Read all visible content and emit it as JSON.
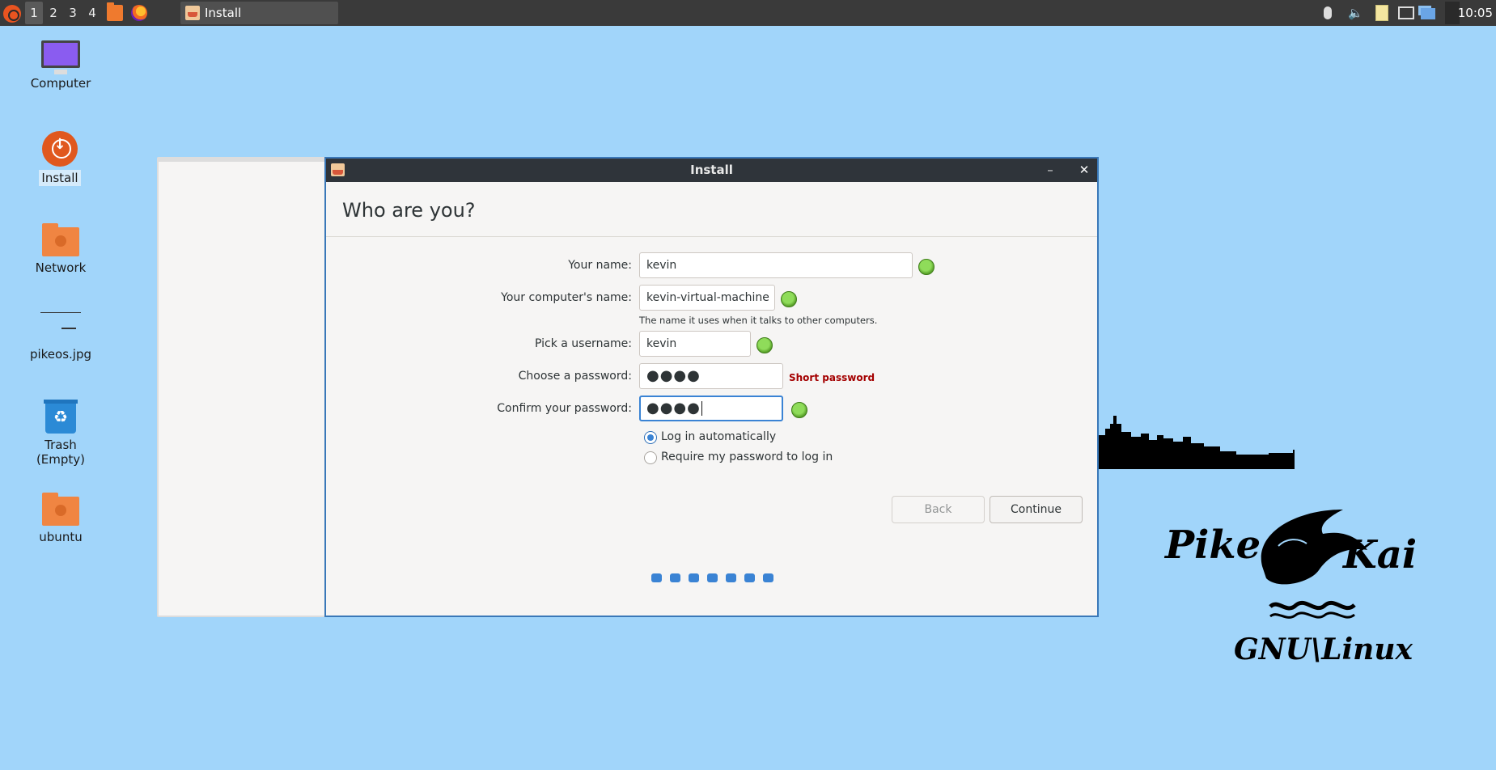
{
  "panel": {
    "workspaces": [
      "1",
      "2",
      "3",
      "4"
    ],
    "task_label": "Install",
    "clock": "10:05"
  },
  "desktop": {
    "icons": [
      {
        "label": "Computer"
      },
      {
        "label": "Install"
      },
      {
        "label": "Network"
      },
      {
        "label": "pikeos.jpg"
      },
      {
        "label": "Trash (Empty)"
      },
      {
        "label": "ubuntu"
      }
    ],
    "logo": {
      "line1_left": "Pike",
      "line1_right": "Kai",
      "line2": "GNU\\Linux"
    }
  },
  "window": {
    "title": "Install",
    "minimize_glyph": "–",
    "close_glyph": "✕",
    "heading": "Who are you?",
    "fields": {
      "name": {
        "label": "Your name:",
        "value": "kevin"
      },
      "computer": {
        "label": "Your computer's name:",
        "value": "kevin-virtual-machine",
        "hint": "The name it uses when it talks to other computers."
      },
      "username": {
        "label": "Pick a username:",
        "value": "kevin"
      },
      "password": {
        "label": "Choose a password:",
        "value": "●●●●",
        "warning": "Short password"
      },
      "confirm": {
        "label": "Confirm your password:",
        "value": "●●●●"
      }
    },
    "login_options": [
      {
        "label": "Log in automatically",
        "selected": true
      },
      {
        "label": "Require my password to log in",
        "selected": false
      }
    ],
    "buttons": {
      "back": "Back",
      "continue": "Continue"
    },
    "progress": {
      "steps": 7
    }
  },
  "colors": {
    "desktop_bg": "#a1d5fa",
    "accent": "#3a83d4",
    "warning": "#a40000",
    "ok": "#5aa22a"
  }
}
